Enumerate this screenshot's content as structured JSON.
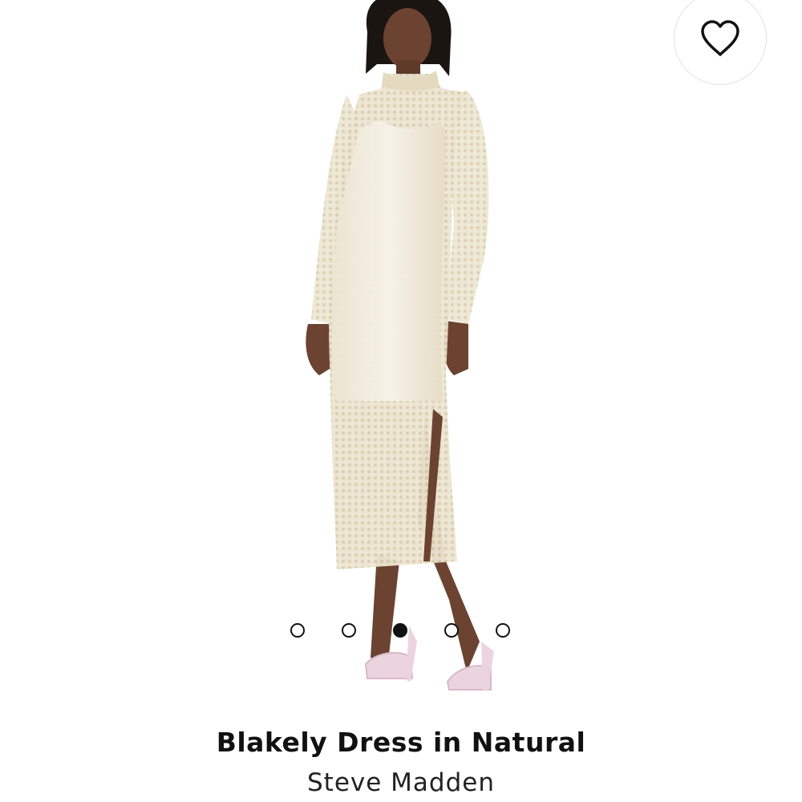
{
  "product": {
    "title": "Blakely Dress in Natural",
    "brand": "Steve Madden",
    "image_icon": "product-photo-model-in-sequin-midi-dress"
  },
  "favorite": {
    "icon": "heart-outline-icon"
  },
  "carousel": {
    "total": 5,
    "active_index": 2
  },
  "colors": {
    "text": "#111111",
    "dress": "#eee7d4",
    "skin": "#6b4330",
    "sandal": "#ecd4de"
  }
}
